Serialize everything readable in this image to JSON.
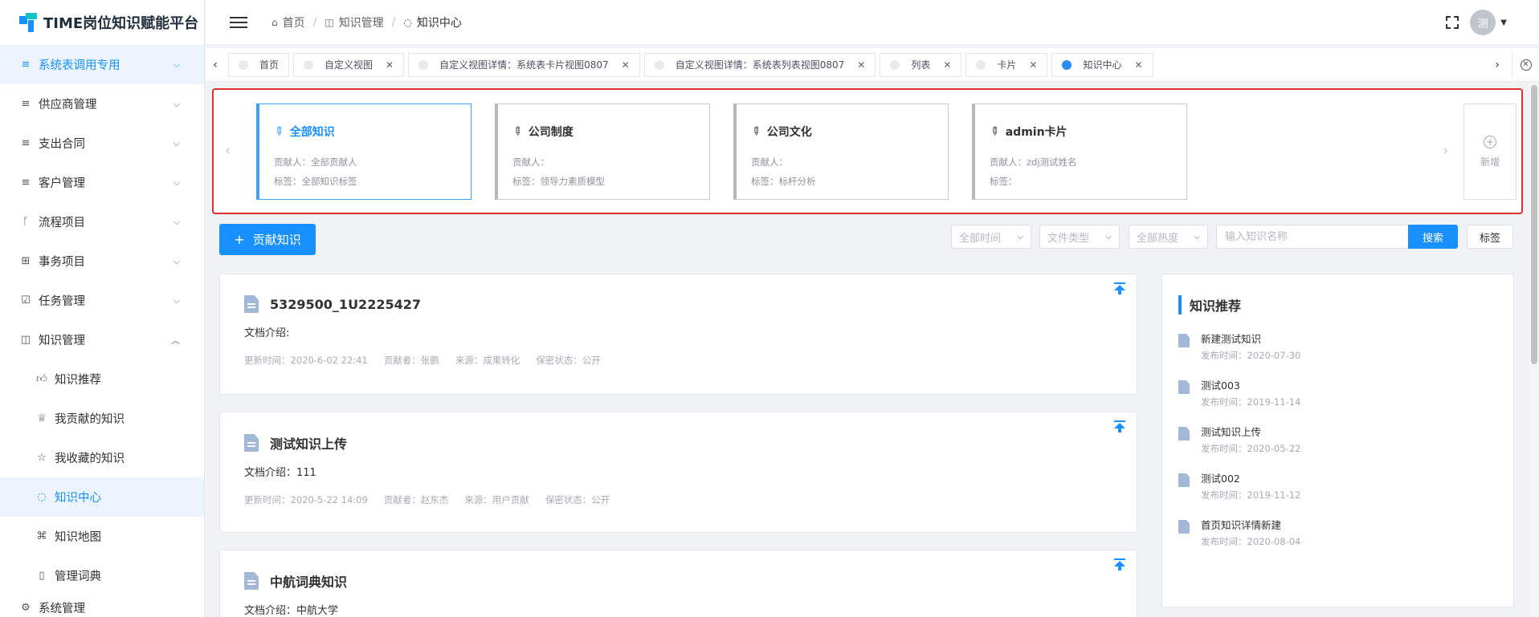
{
  "app": {
    "title": "TIME岗位知识赋能平台"
  },
  "sidebar": {
    "items": [
      {
        "label": "系统表调用专用",
        "icon": "menu-lines-icon",
        "active": true
      },
      {
        "label": "供应商管理",
        "icon": "menu-lines-icon"
      },
      {
        "label": "支出合同",
        "icon": "menu-lines-icon"
      },
      {
        "label": "客户管理",
        "icon": "menu-lines-icon"
      },
      {
        "label": "流程项目",
        "icon": "branch-icon"
      },
      {
        "label": "事务项目",
        "icon": "grid-icon"
      },
      {
        "label": "任务管理",
        "icon": "checkbox-icon"
      },
      {
        "label": "知识管理",
        "icon": "book-icon",
        "expanded": true
      }
    ],
    "submenu": [
      {
        "label": "知识推荐",
        "icon": "thumb-up-icon"
      },
      {
        "label": "我贡献的知识",
        "icon": "trophy-icon"
      },
      {
        "label": "我收藏的知识",
        "icon": "star-icon"
      },
      {
        "label": "知识中心",
        "icon": "bulb-icon",
        "current": true
      },
      {
        "label": "知识地图",
        "icon": "sitemap-icon"
      },
      {
        "label": "管理词典",
        "icon": "document-icon"
      }
    ],
    "cut_item": "系统管理"
  },
  "header": {
    "breadcrumbs": [
      {
        "label": "首页",
        "icon": "home-icon"
      },
      {
        "label": "知识管理",
        "icon": "book-icon"
      },
      {
        "label": "知识中心",
        "icon": "bulb-icon"
      }
    ],
    "avatar_text": "测"
  },
  "tabs": [
    {
      "label": "首页",
      "closable": false
    },
    {
      "label": "自定义视图",
      "closable": true
    },
    {
      "label": "自定义视图详情：系统表卡片视图0807",
      "closable": true
    },
    {
      "label": "自定义视图详情：系统表列表视图0807",
      "closable": true
    },
    {
      "label": "列表",
      "closable": true
    },
    {
      "label": "卡片",
      "closable": true
    },
    {
      "label": "知识中心",
      "closable": true,
      "active": true
    }
  ],
  "knowledge_cards": [
    {
      "title": "全部知识",
      "contributor": "贡献人：全部贡献人",
      "tags": "标签：全部知识标签",
      "active": true
    },
    {
      "title": "公司制度",
      "contributor": "贡献人：",
      "tags": "标签：领导力素质模型"
    },
    {
      "title": "公司文化",
      "contributor": "贡献人：",
      "tags": "标签：标杆分析"
    },
    {
      "title": "admin卡片",
      "contributor": "贡献人：zdj测试姓名",
      "tags": "标签："
    }
  ],
  "add_card_label": "新增",
  "toolbar": {
    "contribute_label": "贡献知识",
    "filters": [
      "全部时间",
      "文件类型",
      "全部热度"
    ],
    "search_placeholder": "输入知识名称",
    "search_label": "搜索",
    "tag_label": "标签"
  },
  "documents": [
    {
      "title": "5329500_1U2225427",
      "intro": "文档介绍:",
      "updated": "更新时间：2020-6-02 22:41",
      "contributor": "贡献者：张鹏",
      "source": "来源：成果转化",
      "secrecy": "保密状态：公开"
    },
    {
      "title": "测试知识上传",
      "intro": "文档介绍：111",
      "updated": "更新时间：2020-5-22 14:09",
      "contributor": "贡献者：赵东杰",
      "source": "来源：用户贡献",
      "secrecy": "保密状态：公开"
    },
    {
      "title": "中航词典知识",
      "intro": "文档介绍：中航大学",
      "updated": "",
      "contributor": "",
      "source": "",
      "secrecy": ""
    }
  ],
  "recommend": {
    "title": "知识推荐",
    "items": [
      {
        "name": "新建测试知识",
        "date": "发布时间：2020-07-30"
      },
      {
        "name": "测试003",
        "date": "发布时间：2019-11-14"
      },
      {
        "name": "测试知识上传",
        "date": "发布时间：2020-05-22"
      },
      {
        "name": "测试002",
        "date": "发布时间：2019-11-12"
      },
      {
        "name": "首页知识详情新建",
        "date": "发布时间：2020-08-04"
      }
    ]
  },
  "colors": {
    "accent": "#1890ff",
    "highlight_border": "#e02d2d"
  }
}
